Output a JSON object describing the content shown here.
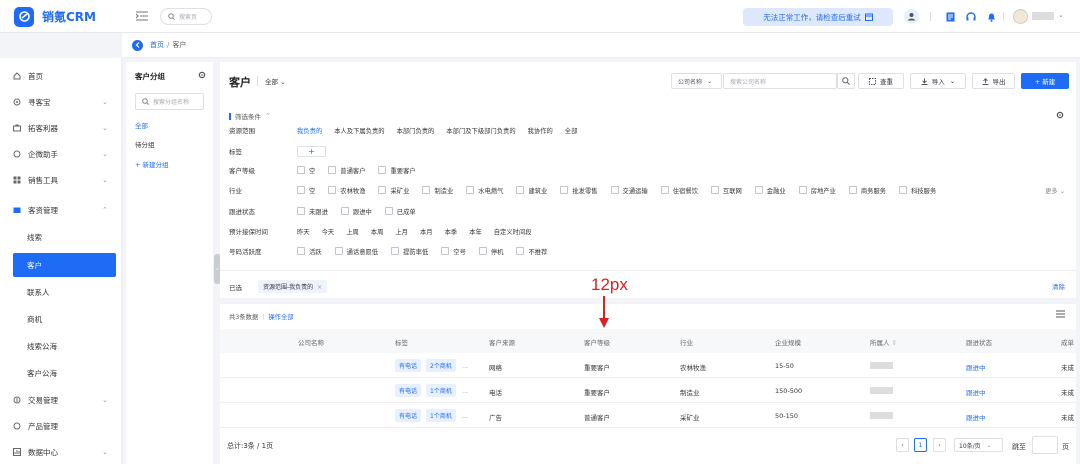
{
  "app": {
    "name": "销氪CRM"
  },
  "header": {
    "search_placeholder": "搜索页",
    "notice": "无法正常工作，请检查后重试",
    "icons": [
      "fold-icon",
      "search-icon",
      "calendar-icon",
      "user-switch-icon",
      "document-icon",
      "headset-icon",
      "bell-icon",
      "avatar",
      "chevron-down-icon"
    ],
    "colors": {
      "brand": "#1e6bf5",
      "notice_bg": "#dde8fd"
    }
  },
  "breadcrumb": {
    "home": "首页",
    "separator": "/",
    "current": "客户"
  },
  "sidebar": {
    "items": [
      {
        "label": "首页",
        "icon": "home-icon"
      },
      {
        "label": "寻客宝",
        "icon": "target-icon"
      },
      {
        "label": "拓客利器",
        "icon": "briefcase-icon"
      },
      {
        "label": "企微助手",
        "icon": "chat-icon"
      },
      {
        "label": "销售工具",
        "icon": "grid-icon"
      },
      {
        "label": "客资管理",
        "icon": "folder-icon"
      },
      {
        "label": "交易管理",
        "icon": "trade-icon"
      },
      {
        "label": "产品管理",
        "icon": "box-icon"
      },
      {
        "label": "数据中心",
        "icon": "chart-icon"
      }
    ],
    "sub_items": [
      "线索",
      "客户",
      "联系人",
      "商机",
      "线索公海",
      "客户公海"
    ],
    "active_sub": "客户"
  },
  "groups": {
    "title": "客户分组",
    "search_placeholder": "搜索分组名称",
    "items": [
      "全部",
      "待分组"
    ],
    "add": "+ 新建分组"
  },
  "main": {
    "title": "客户",
    "scope": "全部",
    "search_field": "公司名称",
    "search_placeholder": "搜索公司名称",
    "dedupe": "查重",
    "import": "导入",
    "export": "导出",
    "new": "+ 新建"
  },
  "filters": {
    "title": "筛选条件",
    "rows": [
      {
        "label": "资源范围",
        "options": [
          "我负责的",
          "本人及下属负责的",
          "本部门负责的",
          "本部门及下级部门负责的",
          "我协作的",
          "全部"
        ],
        "selected": "我负责的"
      },
      {
        "label": "标签",
        "add": "+"
      },
      {
        "label": "客户等级",
        "checks": [
          "空",
          "普通客户",
          "重要客户"
        ]
      },
      {
        "label": "行业",
        "checks": [
          "空",
          "农林牧渔",
          "采矿业",
          "制造业",
          "水电燃气",
          "建筑业",
          "批发零售",
          "交通运输",
          "住宿餐饮",
          "互联网",
          "金融业",
          "房地产业",
          "商务服务",
          "科技服务"
        ],
        "more": "更多"
      },
      {
        "label": "跟进状态",
        "checks": [
          "未跟进",
          "跟进中",
          "已成单"
        ]
      },
      {
        "label": "预计接保时间",
        "options": [
          "昨天",
          "今天",
          "上周",
          "本周",
          "上月",
          "本月",
          "本季",
          "本年",
          "自定义时间段"
        ]
      },
      {
        "label": "号码活跃度",
        "checks": [
          "活跃",
          "通话意愿低",
          "提防率低",
          "空号",
          "停机",
          "不推荐"
        ]
      }
    ]
  },
  "selected_bar": {
    "label": "已选",
    "chip": "资源范围-我负责的",
    "clear": "清除"
  },
  "table": {
    "count_text": "共3条数据",
    "op_all": "操作全部",
    "columns": [
      "公司名称",
      "标签",
      "客户来源",
      "客户等级",
      "行业",
      "企业规模",
      "所属人",
      "跟进状态",
      "成单"
    ],
    "rows": [
      {
        "tags": [
          "有电话",
          "2个商机"
        ],
        "more": "...",
        "source": "网络",
        "level": "重要客户",
        "industry": "农林牧渔",
        "scale": "15-50",
        "status": "跟进中",
        "deal": "未成"
      },
      {
        "tags": [
          "有电话",
          "1个商机"
        ],
        "more": "...",
        "source": "电话",
        "level": "重要客户",
        "industry": "制造业",
        "scale": "150-500",
        "status": "跟进中",
        "deal": "未成"
      },
      {
        "tags": [
          "有电话",
          "1个商机"
        ],
        "more": "...",
        "source": "广告",
        "level": "普通客户",
        "industry": "采矿业",
        "scale": "50-150",
        "status": "跟进中",
        "deal": "未成"
      }
    ]
  },
  "pagination": {
    "total": "总计:3条 / 1页",
    "current": "1",
    "page_size": "10条/页",
    "goto": "跳至",
    "page_unit": "页"
  },
  "annotation": {
    "text": "12px"
  }
}
